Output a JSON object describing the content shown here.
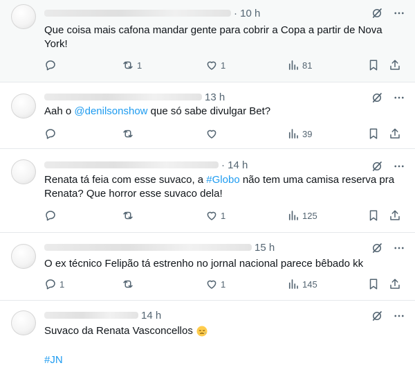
{
  "posts": [
    {
      "time": "· 10 h",
      "text": "Que coisa mais cafona mandar gente para cobrir a Copa a partir de Nova York!",
      "reply_count": "",
      "repost_count": "1",
      "like_count": "1",
      "view_count": "81"
    },
    {
      "time": "13 h",
      "text_prefix": "Aah o ",
      "mention": "@denilsonshow",
      "text_suffix": " que só sabe divulgar Bet?",
      "reply_count": "",
      "repost_count": "",
      "like_count": "",
      "view_count": "39"
    },
    {
      "time": "· 14 h",
      "text_prefix": "Renata tá feia com esse suvaco, a ",
      "hashtag": "#Globo",
      "text_suffix": " não tem uma camisa reserva pra Renata? Que horror esse suvaco dela!",
      "reply_count": "",
      "repost_count": "",
      "like_count": "1",
      "view_count": "125"
    },
    {
      "time": "15 h",
      "text": "O ex técnico Felipão tá estrenho no jornal nacional parece bêbado kk",
      "reply_count": "1",
      "repost_count": "",
      "like_count": "1",
      "view_count": "145"
    },
    {
      "time": "14 h",
      "text": "Suvaco da Renata Vasconcellos",
      "hashtag": "#JN"
    }
  ],
  "icons": {
    "grok": "grok-icon",
    "more": "more-icon",
    "reply": "reply-icon",
    "repost": "repost-icon",
    "like": "like-icon",
    "views": "views-icon",
    "bookmark": "bookmark-icon",
    "share": "share-icon",
    "emoji": "sleepy-face-emoji"
  },
  "colors": {
    "link": "#1d9bf0",
    "muted": "#536471",
    "text": "#0f1419",
    "highlight_bg": "#f7f9f9"
  }
}
